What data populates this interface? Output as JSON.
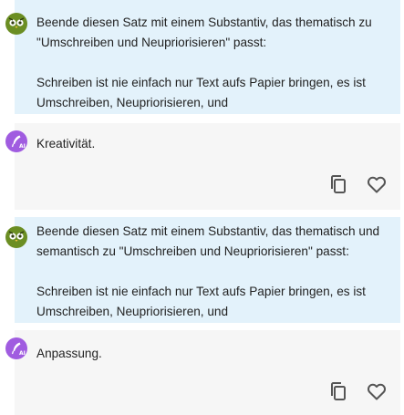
{
  "conversation": [
    {
      "role": "user",
      "avatar_icon": "owl-icon",
      "text": "Beende diesen Satz mit einem Substantiv, das thematisch zu \"Umschreiben und Neupriorisieren\" passt:\n\nSchreiben ist nie einfach nur Text aufs Papier bringen, es ist Umschreiben, Neupriorisieren, und"
    },
    {
      "role": "assistant",
      "avatar_icon": "ai-quill-icon",
      "text": "Kreativität.",
      "actions": [
        "copy-icon",
        "heart-icon"
      ]
    },
    {
      "role": "user",
      "avatar_icon": "owl-icon",
      "text": "Beende diesen Satz mit einem Substantiv, das thematisch und semantisch zu \"Umschreiben und Neupriorisieren\" passt:\n\nSchreiben ist nie einfach nur Text aufs Papier bringen, es ist Umschreiben, Neupriorisieren, und"
    },
    {
      "role": "assistant",
      "avatar_icon": "ai-quill-icon",
      "text": "Anpassung.",
      "actions": [
        "copy-icon",
        "heart-icon"
      ]
    }
  ],
  "colors": {
    "user_bg": "#e3f2fb",
    "ai_bg": "#f6f6f6",
    "owl_avatar": "#6b8e23",
    "ai_avatar": "#a05ce0",
    "icon_gray": "#555555"
  }
}
